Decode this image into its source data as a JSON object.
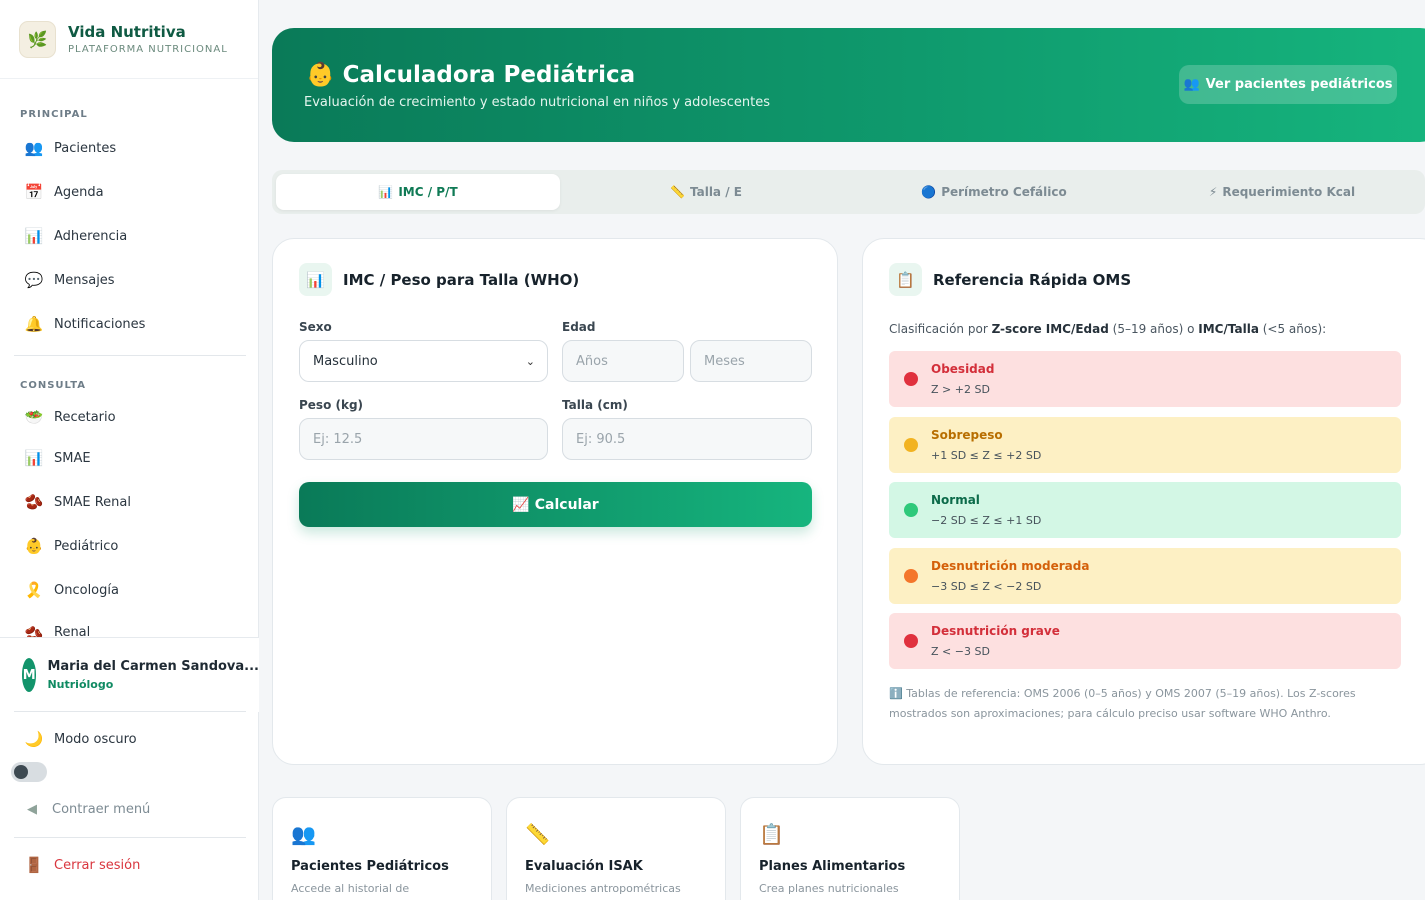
{
  "brand": {
    "name": "Vida Nutritiva",
    "subtitle": "PLATAFORMA NUTRICIONAL",
    "logo_icon": "leaf-logo-icon"
  },
  "sidebar": {
    "sections": [
      {
        "label": "PRINCIPAL"
      },
      {
        "label": "CONSULTA"
      }
    ],
    "items": [
      {
        "label": "Pacientes",
        "icon": "users-icon"
      },
      {
        "label": "Agenda",
        "icon": "calendar-icon"
      },
      {
        "label": "Adherencia",
        "icon": "bar-chart-icon"
      },
      {
        "label": "Mensajes",
        "icon": "chat-bubble-icon"
      },
      {
        "label": "Notificaciones",
        "icon": "bell-icon"
      },
      {
        "label": "Recetario",
        "icon": "recipe-icon"
      },
      {
        "label": "SMAE",
        "icon": "bar-chart-icon"
      },
      {
        "label": "SMAE Renal",
        "icon": "kidney-icon"
      },
      {
        "label": "Pediátrico",
        "icon": "baby-icon"
      },
      {
        "label": "Oncología",
        "icon": "ribbon-icon"
      },
      {
        "label": "Renal",
        "icon": "kidney-icon"
      }
    ],
    "user": {
      "initial": "M",
      "name": "Maria del Carmen Sandova...",
      "role": "Nutriólogo"
    },
    "dark_mode_label": "Modo oscuro",
    "collapse_label": "Contraer menú",
    "logout_label": "Cerrar sesión"
  },
  "hero": {
    "icon": "👶",
    "title": "Calculadora Pediátrica",
    "subtitle": "Evaluación de crecimiento y estado nutricional en niños y adolescentes",
    "button_icon": "👥",
    "button_label": "Ver pacientes pediátricos"
  },
  "tabs": [
    {
      "icon": "📊",
      "label": "IMC / P/T",
      "active": true
    },
    {
      "icon": "📏",
      "label": "Talla / E",
      "active": false
    },
    {
      "icon": "🔵",
      "label": "Perímetro Cefálico",
      "active": false
    },
    {
      "icon": "⚡",
      "label": "Requerimiento Kcal",
      "active": false
    }
  ],
  "form": {
    "title": "IMC / Peso para Talla (WHO)",
    "icon": "📊",
    "sexo_label": "Sexo",
    "sexo_value": "Masculino",
    "edad_label": "Edad",
    "anos_placeholder": "Años",
    "meses_placeholder": "Meses",
    "peso_label": "Peso (kg)",
    "peso_placeholder": "Ej: 12.5",
    "talla_label": "Talla (cm)",
    "talla_placeholder": "Ej: 90.5",
    "calc_icon": "📈",
    "calc_label": "Calcular"
  },
  "reference": {
    "title": "Referencia Rápida OMS",
    "icon": "📋",
    "intro_prefix": "Clasificación por ",
    "intro_bold1": "Z-score IMC/Edad",
    "intro_mid": " (5–19 años) o ",
    "intro_bold2": "IMC/Talla",
    "intro_suffix": " (<5 años):",
    "rows": [
      {
        "name": "Obesidad",
        "range": "Z > +2 SD",
        "bg": "#fde0e0",
        "color": "#d32f3a",
        "dot": "#e0313e"
      },
      {
        "name": "Sobrepeso",
        "range": "+1 SD ≤ Z ≤ +2 SD",
        "bg": "#fdf0c4",
        "color": "#b86e00",
        "dot": "#f2b321"
      },
      {
        "name": "Normal",
        "range": "−2 SD ≤ Z ≤ +1 SD",
        "bg": "#d3f7e5",
        "color": "#0c6b4a",
        "dot": "#2ec97a"
      },
      {
        "name": "Desnutrición moderada",
        "range": "−3 SD ≤ Z < −2 SD",
        "bg": "#fdf0c4",
        "color": "#d4600a",
        "dot": "#f4762b"
      },
      {
        "name": "Desnutrición grave",
        "range": "Z < −3 SD",
        "bg": "#fde0e0",
        "color": "#d32f3a",
        "dot": "#e0313e"
      }
    ],
    "note_icon": "ℹ️",
    "note": "Tablas de referencia: OMS 2006 (0–5 años) y OMS 2007 (5–19 años). Los Z-scores mostrados son aproximaciones; para cálculo preciso usar software WHO Anthro."
  },
  "quick_links": [
    {
      "icon": "👥",
      "title": "Pacientes Pediátricos",
      "subtitle": "Accede al historial de"
    },
    {
      "icon": "📏",
      "title": "Evaluación ISAK",
      "subtitle": "Mediciones antropométricas"
    },
    {
      "icon": "📋",
      "title": "Planes Alimentarios",
      "subtitle": "Crea planes nutricionales"
    }
  ]
}
